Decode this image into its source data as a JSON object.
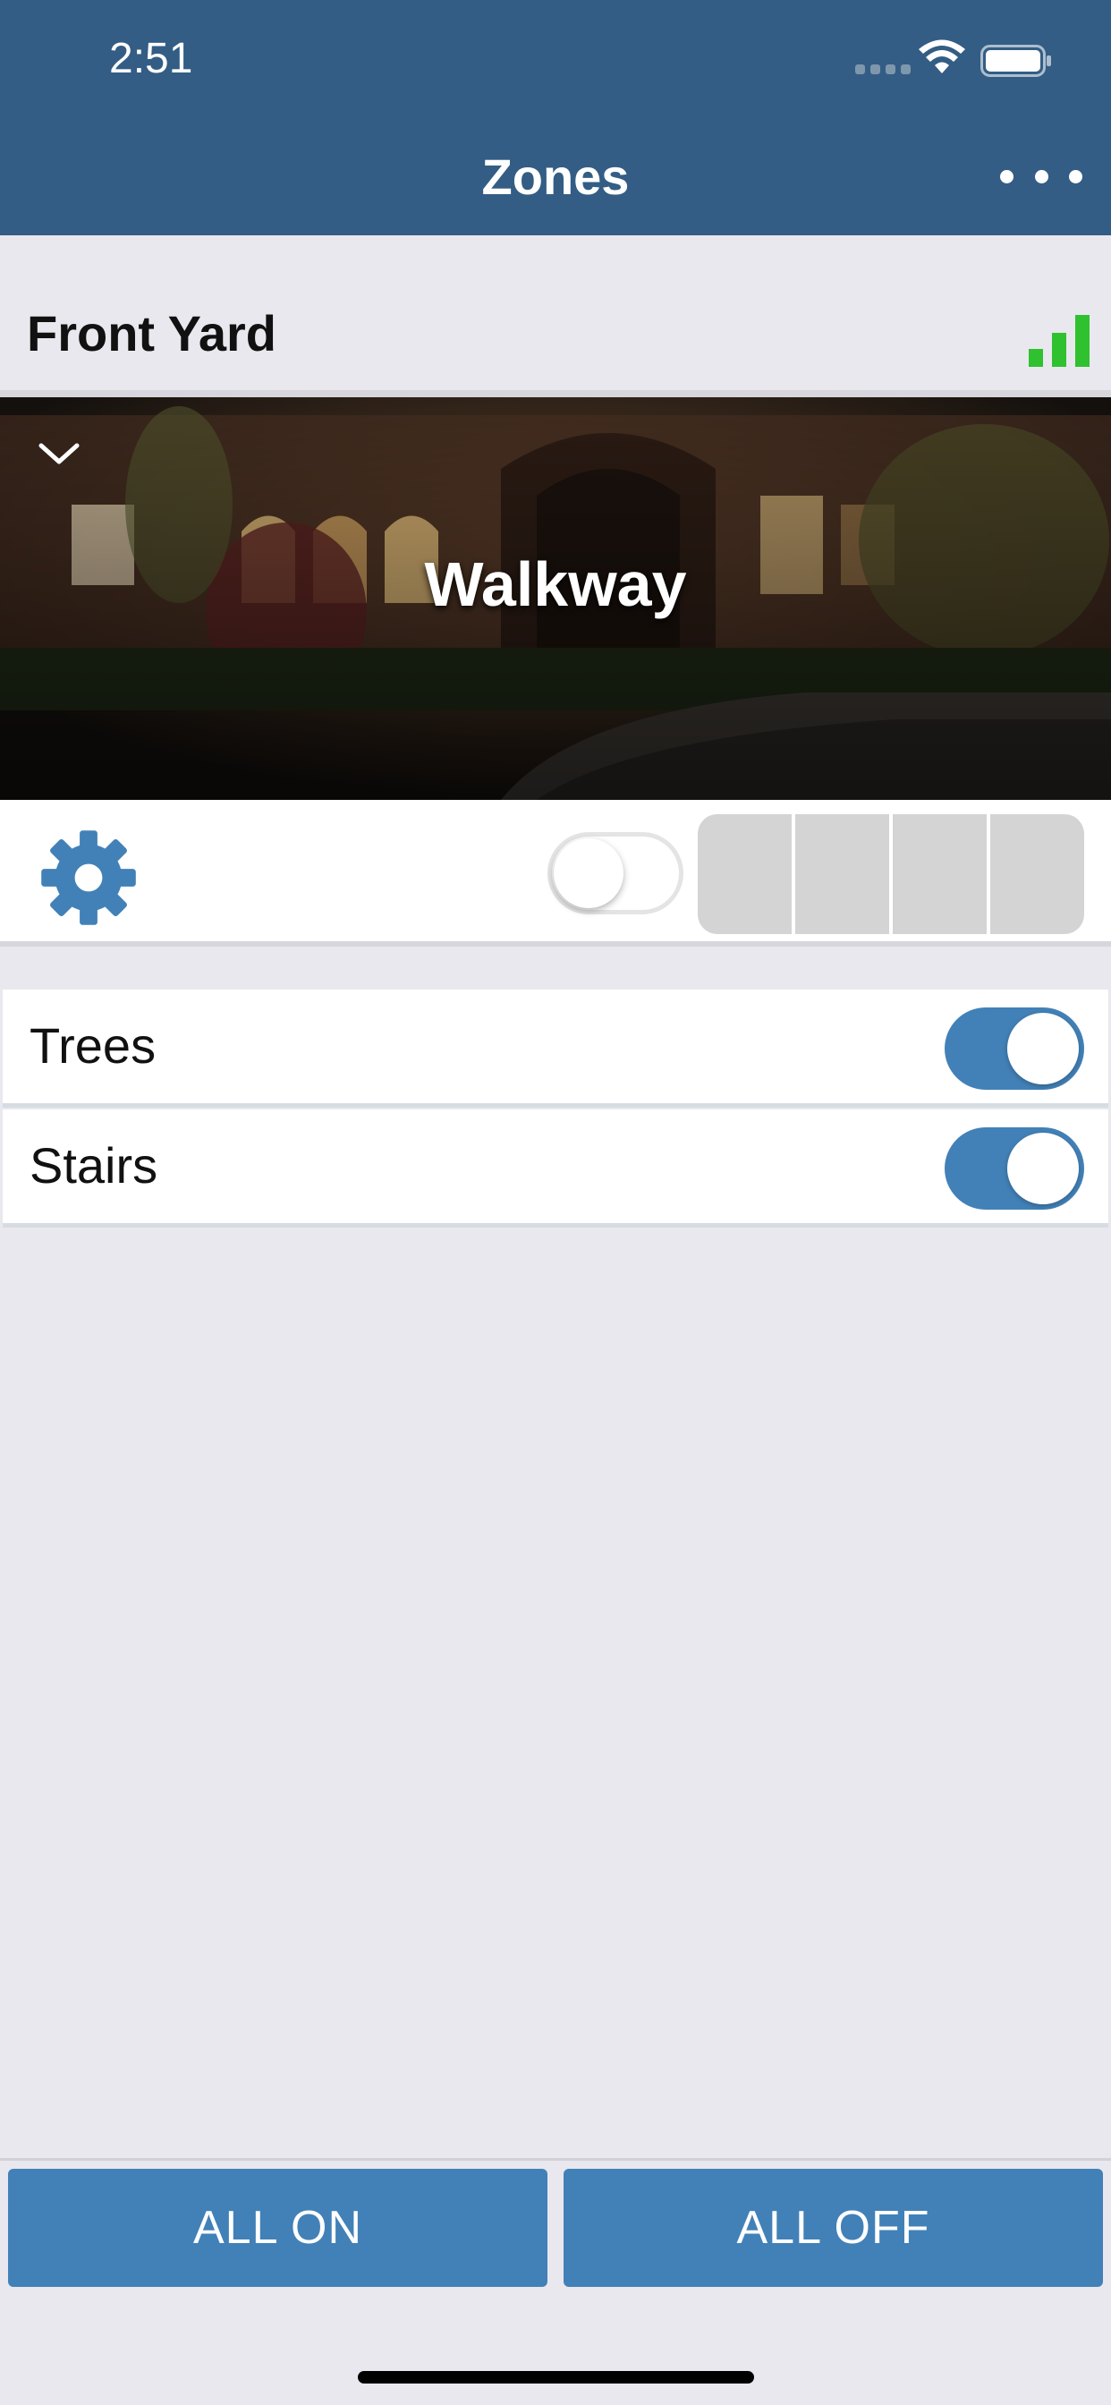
{
  "status_bar": {
    "time": "2:51"
  },
  "header": {
    "title": "Zones",
    "menu_icon": "more-dots-icon"
  },
  "group": {
    "name": "Front Yard",
    "signal_icon": "signal-bars-icon",
    "signal_color": "#2fc12f"
  },
  "zone": {
    "name": "Walkway",
    "expanded": true,
    "power_on": false
  },
  "lights": [
    {
      "label": "Trees",
      "on": true
    },
    {
      "label": "Stairs",
      "on": true
    }
  ],
  "footer": {
    "all_on_label": "ALL ON",
    "all_off_label": "ALL OFF"
  },
  "colors": {
    "header_bg": "#335d84",
    "accent": "#4281b7",
    "background": "#e9e8ee"
  }
}
